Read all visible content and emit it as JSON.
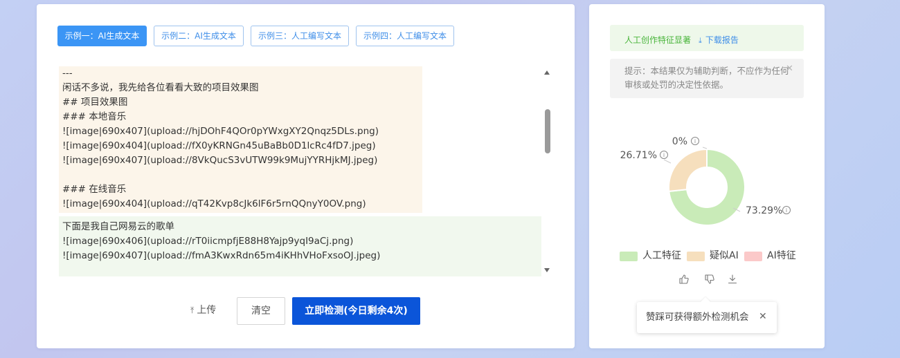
{
  "examples": [
    {
      "label": "示例一：AI生成文本",
      "active": true
    },
    {
      "label": "示例二：AI生成文本",
      "active": false
    },
    {
      "label": "示例三：人工编写文本",
      "active": false
    },
    {
      "label": "示例四：人工编写文本",
      "active": false
    }
  ],
  "editor": {
    "segment_suspect": [
      "---",
      "闲话不多说，我先给各位看看大致的项目效果图",
      "## 项目效果图",
      "### 本地音乐",
      "![image|690x407](upload://hjDOhF4QOr0pYWxgXY2Qnqz5DLs.png)",
      "![image|690x404](upload://fX0yKRNGn45uBaBb0D1lcRc4fD7.jpeg)",
      "![image|690x407](upload://8VkQucS3vUTW99k9MujYYRHjkMJ.jpeg)",
      "",
      "### 在线音乐",
      "![image|690x404](upload://qT42Kvp8cJk6lF6r5rnQQnyY0OV.png)"
    ],
    "segment_human": [
      "下面是我自己网易云的歌单",
      "![image|690x406](upload://rT0iicmpfjE88H8Yajp9yqI9aCj.png)",
      "![image|690x407](upload://fmA3KwxRdn65m4iKHhVHoFxsoOJ.jpeg)"
    ]
  },
  "actions": {
    "upload_label": "上传",
    "clear_label": "清空",
    "detect_label": "立即检测(今日剩余4次)"
  },
  "result": {
    "label": "人工创作特征显著",
    "download_label": "下载报告",
    "notice": "提示：本结果仅为辅助判断，不应作为任何审核或处罚的决定性依据。"
  },
  "chart_data": {
    "type": "pie",
    "variant": "donut",
    "slices": [
      {
        "name": "人工特征",
        "value": 73.29,
        "label": "73.29%",
        "color": "#c9ebb8"
      },
      {
        "name": "疑似AI",
        "value": 26.71,
        "label": "26.71%",
        "color": "#f6dfbd"
      },
      {
        "name": "AI特征",
        "value": 0,
        "label": "0%",
        "color": "#fbc9c9"
      }
    ],
    "legend_position": "bottom"
  },
  "tooltip": {
    "text": "赞踩可获得额外检测机会"
  },
  "colors": {
    "accent": "#0b55d9",
    "tab_active": "#3b95f5",
    "success": "#49b53b"
  }
}
